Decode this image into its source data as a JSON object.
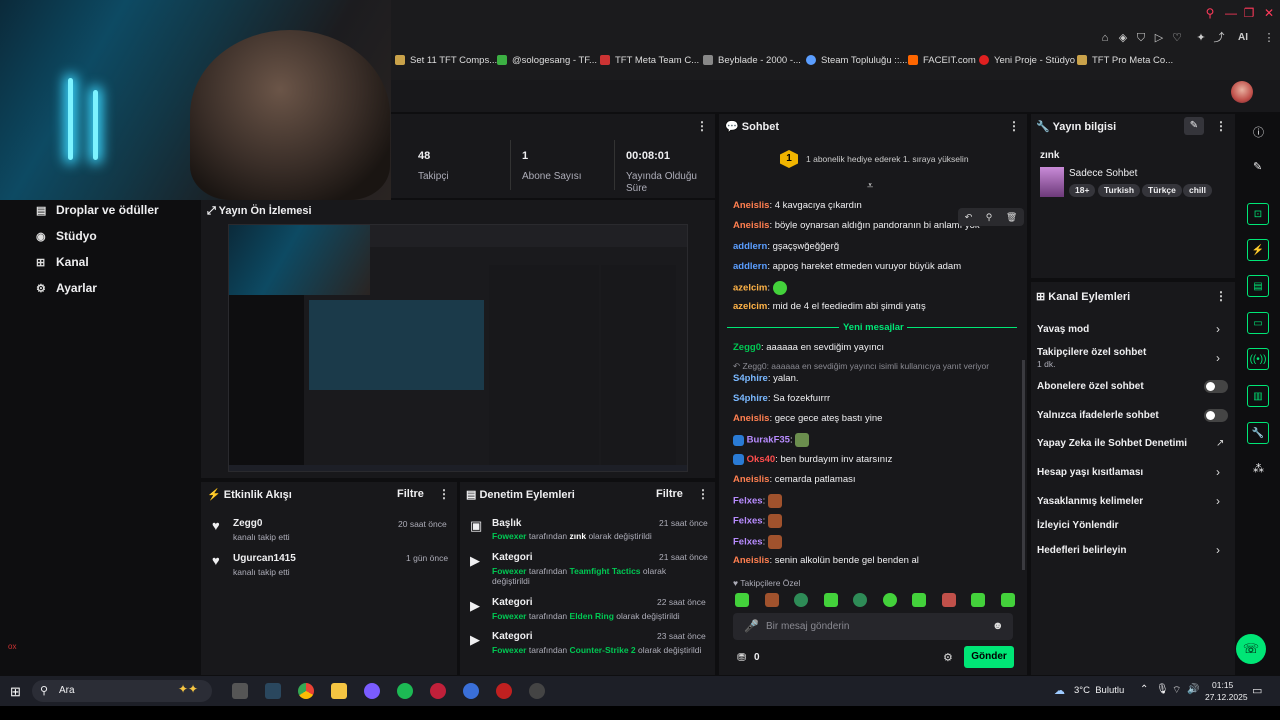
{
  "browser": {
    "bookmarks": [
      "Set 11 TFT Comps...",
      "@sologesang - TF...",
      "TFT Meta Team C...",
      "Beyblade - 2000 -...",
      "Steam Topluluğu ::...",
      "FACEIT.com",
      "Yeni Proje - Stüdyo",
      "TFT Pro Meta Co..."
    ],
    "ai_label": "AI"
  },
  "sidebar": {
    "items": [
      {
        "label": "Droplar ve ödüller",
        "icon": "gift-icon"
      },
      {
        "label": "Stüdyo",
        "icon": "studio-icon"
      },
      {
        "label": "Kanal",
        "icon": "channel-icon"
      },
      {
        "label": "Ayarlar",
        "icon": "gear-icon"
      }
    ]
  },
  "stats": [
    {
      "value": "48",
      "label": "Takipçi"
    },
    {
      "value": "1",
      "label": "Abone Sayısı"
    },
    {
      "value": "00:08:01",
      "label": "Yayında Olduğu Süre"
    }
  ],
  "preview": {
    "title": "Yayın Ön İzlemesi"
  },
  "activity": {
    "title": "Etkinlik Akışı",
    "filter": "Filtre",
    "items": [
      {
        "name": "Zegg0",
        "desc": "kanalı takip etti",
        "time": "20 saat önce"
      },
      {
        "name": "Ugurcan1415",
        "desc": "kanalı takip etti",
        "time": "1 gün önce"
      }
    ]
  },
  "moderation": {
    "title": "Denetim Eylemleri",
    "filter": "Filtre",
    "items": [
      {
        "kind": "Başlık",
        "who": "Fowexer",
        "mid": "tarafından",
        "val": "zınk",
        "end": "olarak değiştirildi",
        "time": "21 saat önce"
      },
      {
        "kind": "Kategori",
        "who": "Fowexer",
        "mid": "tarafından",
        "val": "Teamfight Tactics",
        "end": "olarak değiştirildi",
        "time": "21 saat önce"
      },
      {
        "kind": "Kategori",
        "who": "Fowexer",
        "mid": "tarafından",
        "val": "Elden Ring",
        "end": "olarak değiştirildi",
        "time": "22 saat önce"
      },
      {
        "kind": "Kategori",
        "who": "Fowexer",
        "mid": "tarafından",
        "val": "Counter-Strike 2",
        "end": "olarak değiştirildi",
        "time": "23 saat önce"
      }
    ]
  },
  "chat": {
    "title": "Sohbet",
    "pinned": "1 abonelik hediye ederek 1. sıraya yükselin",
    "pinned_rank": "1",
    "new_messages": "Yeni mesajlar",
    "reply_ctx": "Zegg0: aaaaaa en sevdiğim yayıncı isimli kullanıcıya yanıt veriyor",
    "messages": [
      {
        "user": "Aneislis",
        "text": ": 4 kavgacıya çıkardın"
      },
      {
        "user": "Aneislis",
        "text": ": böyle oynarsan aldığın pandoranın bi anlamı yok"
      },
      {
        "user": "addlern",
        "text": ": gşaçşwğeğğerğ"
      },
      {
        "user": "addlern",
        "text": ": appoş hareket etmeden vuruyor büyük adam"
      },
      {
        "user": "azelcim",
        "text": ":"
      },
      {
        "user": "azelcim",
        "text": ": mid de 4 el feediedim abi şimdi yatış"
      },
      {
        "user": "Zegg0",
        "text": ": aaaaaa en sevdiğim yayıncı"
      },
      {
        "user": "S4phire",
        "text": ": yalan."
      },
      {
        "user": "S4phire",
        "text": ": Sa fozekfuırrr"
      },
      {
        "user": "Aneislis",
        "text": ": gece gece ateş bastı yine"
      },
      {
        "user": "BurakF35",
        "text": ":"
      },
      {
        "user": "Oks40",
        "text": ": ben burdayım inv atarsınız"
      },
      {
        "user": "Aneislis",
        "text": ": cemarda patlaması"
      },
      {
        "user": "Felxes",
        "text": ":"
      },
      {
        "user": "Felxes",
        "text": ":"
      },
      {
        "user": "Felxes",
        "text": ":"
      },
      {
        "user": "Aneislis",
        "text": ": senin alkolün bende gel benden al"
      }
    ],
    "followers_only": "Takipçilere Özel",
    "input_placeholder": "Bir mesaj gönderin",
    "points": "0",
    "send": "Gönder"
  },
  "stream_info": {
    "title": "Yayın bilgisi",
    "stream_title": "zınk",
    "category": "Sadece Sohbet",
    "tags": [
      "18+",
      "Turkish",
      "Türkçe",
      "chill"
    ]
  },
  "channel_actions": {
    "title": "Kanal Eylemleri",
    "items": [
      {
        "label": "Yavaş mod",
        "type": "chevron"
      },
      {
        "label": "Takipçilere özel sohbet",
        "sub": "1 dk.",
        "type": "chevron"
      },
      {
        "label": "Abonelere özel sohbet",
        "type": "toggle"
      },
      {
        "label": "Yalnızca ifadelerle sohbet",
        "type": "toggle"
      },
      {
        "label": "Yapay Zeka ile Sohbet Denetimi",
        "type": "external"
      },
      {
        "label": "Hesap yaşı kısıtlaması",
        "type": "chevron"
      },
      {
        "label": "Yasaklanmış kelimeler",
        "type": "chevron"
      },
      {
        "label": "İzleyici Yönlendir",
        "type": "none"
      },
      {
        "label": "Hedefleri belirleyin",
        "type": "chevron"
      }
    ]
  },
  "taskbar": {
    "search": "Ara",
    "weather": "3°C  Bulutlu",
    "time": "01:15",
    "date": "27.12.2025"
  },
  "colors": {
    "accent": "#00e676",
    "bg": "#0e0e10",
    "panel": "#18181b"
  }
}
